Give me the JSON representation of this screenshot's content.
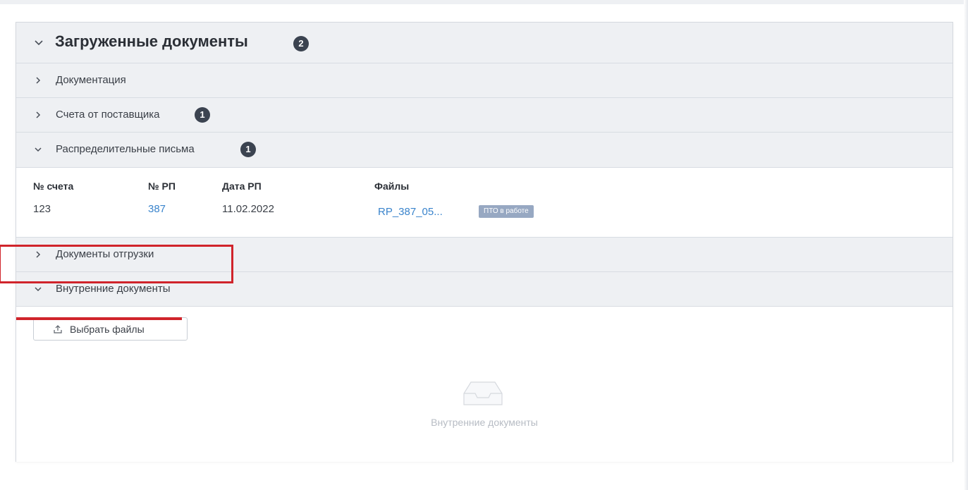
{
  "panel": {
    "title": "Загруженные документы",
    "count": "2"
  },
  "sections": {
    "documentation": {
      "label": "Документация"
    },
    "supplier_invoices": {
      "label": "Счета от поставщика",
      "count": "1"
    },
    "distribution_letters": {
      "label": "Распределительные письма",
      "count": "1"
    },
    "shipping_docs": {
      "label": "Документы отгрузки"
    },
    "internal_docs": {
      "label": "Внутренние документы"
    }
  },
  "table": {
    "headers": {
      "invoice_no": "№ счета",
      "rp_no": "№ РП",
      "rp_date": "Дата РП",
      "files": "Файлы"
    },
    "rows": [
      {
        "invoice_no": "123",
        "rp_no": "387",
        "rp_date": "11.02.2022",
        "file": "RP_387_05...",
        "status": "ПТО в работе"
      }
    ]
  },
  "upload": {
    "label": "Выбрать файлы"
  },
  "empty_state": {
    "text": "Внутренние документы",
    "icon": "inbox-icon"
  },
  "colors": {
    "highlight": "#d0242b",
    "link": "#3a84cc",
    "badge": "#3b4350",
    "status_tag": "#97a8c2"
  }
}
